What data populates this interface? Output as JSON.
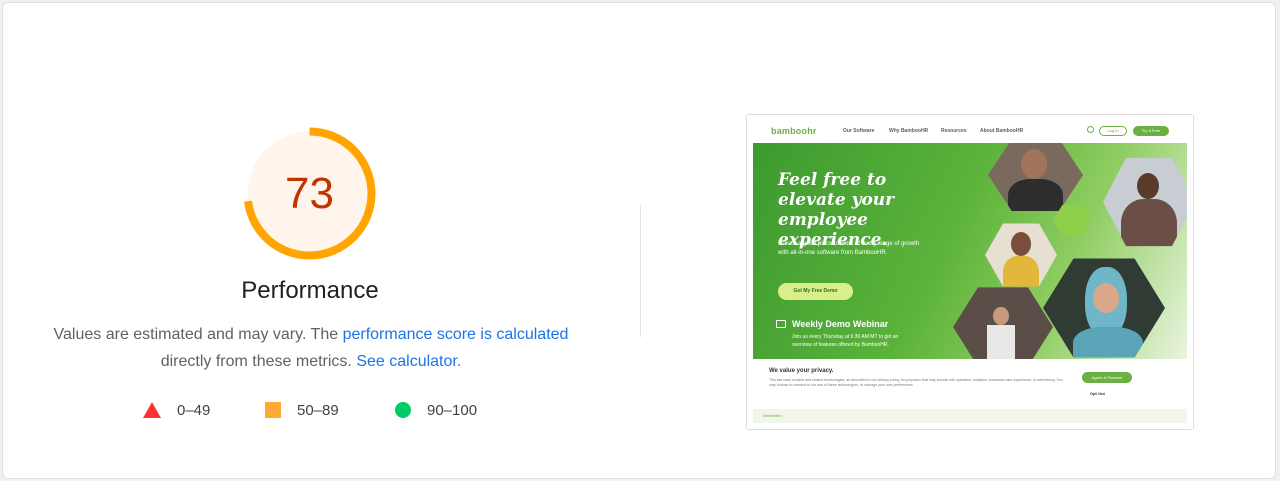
{
  "score": {
    "value": "73",
    "fraction": 0.73,
    "color": "#ffa400",
    "text_color": "#c33300",
    "bg_color": "#fff5ec"
  },
  "category_title": "Performance",
  "description": {
    "text_before": "Values are estimated and may vary. The ",
    "link1": "performance score is calculated",
    "text_middle": "directly from these metrics. ",
    "link2": "See calculator."
  },
  "legend": [
    {
      "icon": "triangle-icon",
      "range": "0–49",
      "color": "#ff3333"
    },
    {
      "icon": "square-icon",
      "range": "50–89",
      "color": "#ffaa33"
    },
    {
      "icon": "circle-icon",
      "range": "90–100",
      "color": "#00cc66"
    }
  ],
  "thumbnail": {
    "logo": "bamboohr",
    "nav_links": [
      "Our Software",
      "Why BambooHR",
      "Resources",
      "About BambooHR"
    ],
    "login": "Log In",
    "try_free": "Try It Free",
    "hero_heading": "Feel free to elevate your employee experience.",
    "hero_text": "Create a great place to work at every stage of growth with all-in-one software from BambooHR.",
    "hero_button": "Get My Free Demo",
    "webinar_title": "Weekly Demo Webinar",
    "webinar_text": "Join us every Thursday at 9:30 AM MT to get an overview of features offered by BambooHR.",
    "privacy_title": "We value your privacy.",
    "privacy_text": "This site uses cookies and related technologies, as described in our privacy policy, for purposes that may include site operation, analytics, enhanced user experience, or advertising. You may choose to consent to our use of these technologies, or manage your own preferences.",
    "privacy_agree": "Agree & Proceed",
    "privacy_opt_out": "Opt Out",
    "footer_text": "Newsletter"
  }
}
